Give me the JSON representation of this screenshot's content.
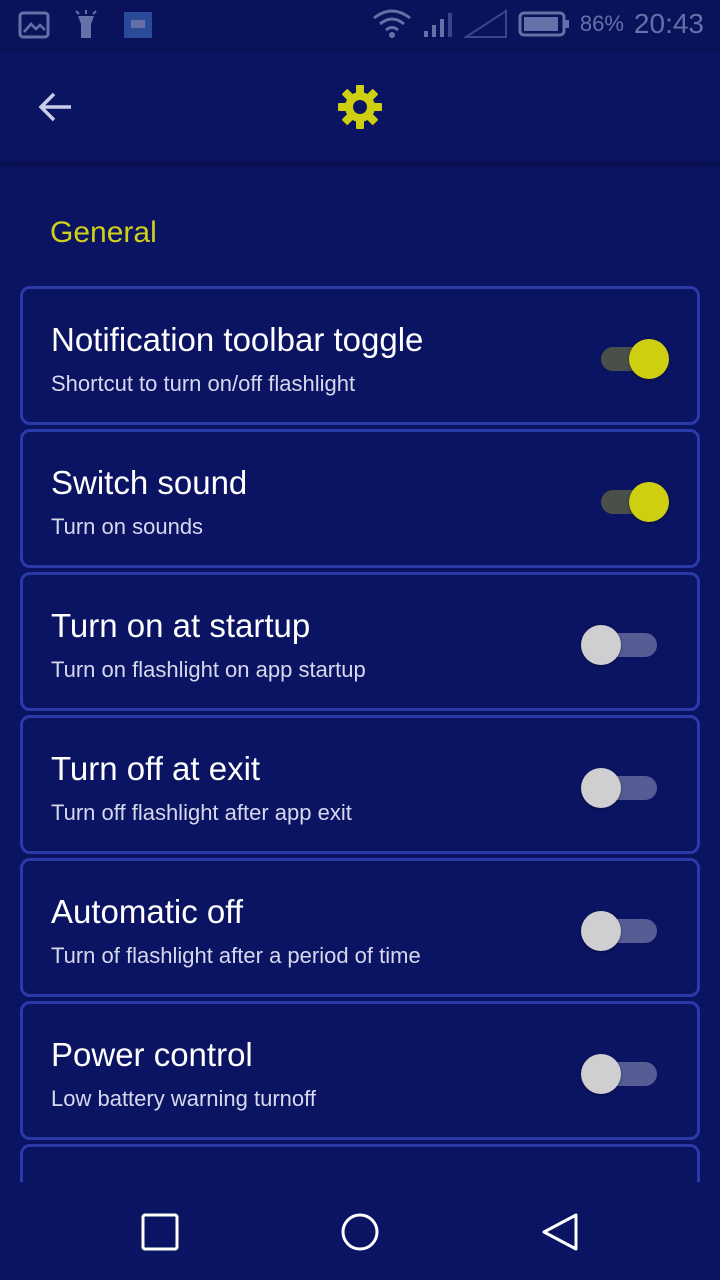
{
  "status_bar": {
    "battery_percent": "86%",
    "time": "20:43"
  },
  "app_bar": {
    "back_icon": "arrow-left-icon",
    "center_icon": "gear-icon",
    "accent_color": "#cfcf1a"
  },
  "section": {
    "title": "General"
  },
  "settings": [
    {
      "title": "Notification toolbar toggle",
      "subtitle": "Shortcut to turn on/off flashlight",
      "enabled": true
    },
    {
      "title": "Switch sound",
      "subtitle": "Turn on sounds",
      "enabled": true
    },
    {
      "title": "Turn on at startup",
      "subtitle": "Turn on flashlight on app startup",
      "enabled": false
    },
    {
      "title": "Turn off at exit",
      "subtitle": "Turn off flashlight after app exit",
      "enabled": false
    },
    {
      "title": "Automatic off",
      "subtitle": "Turn of flashlight after a period of time",
      "enabled": false
    },
    {
      "title": "Power control",
      "subtitle": "Low battery warning turnoff",
      "enabled": false
    }
  ],
  "nav_bar": {
    "recents_icon": "square-icon",
    "home_icon": "circle-icon",
    "back_icon": "triangle-back-icon"
  }
}
